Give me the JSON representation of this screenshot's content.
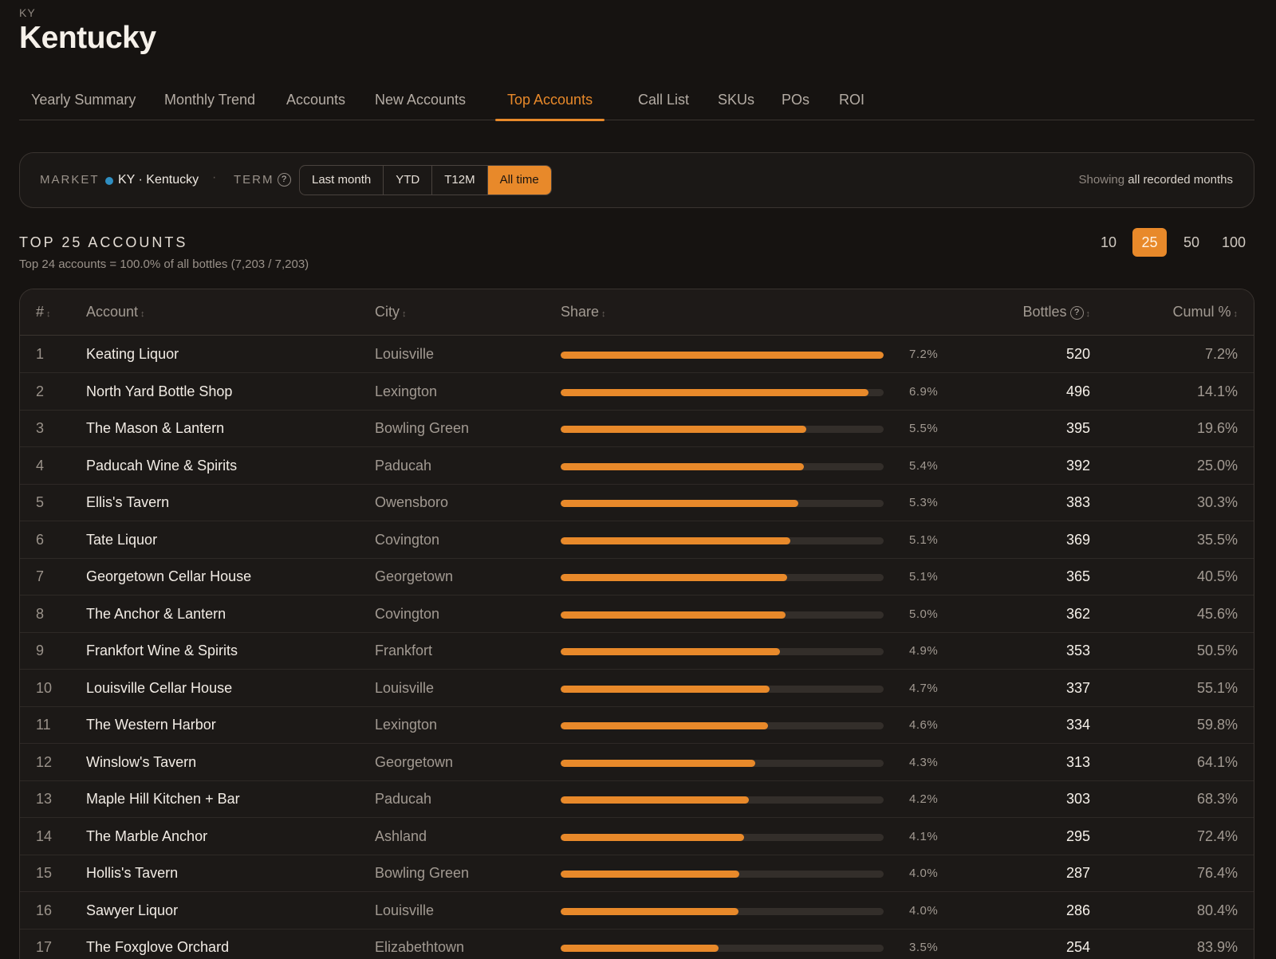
{
  "header": {
    "code": "KY",
    "title": "Kentucky"
  },
  "tabs": [
    {
      "label": "Yearly Summary",
      "active": false
    },
    {
      "label": "Monthly Trend",
      "active": false
    },
    {
      "label": "Accounts",
      "active": false
    },
    {
      "label": "New Accounts",
      "active": false
    },
    {
      "label": "Top Accounts",
      "active": true
    },
    {
      "label": "Call List",
      "active": false
    },
    {
      "label": "SKUs",
      "active": false
    },
    {
      "label": "POs",
      "active": false
    },
    {
      "label": "ROI",
      "active": false
    }
  ],
  "filters": {
    "market_label": "MARKET",
    "market_value": "KY · Kentucky",
    "separator": "·",
    "term_label": "TERM",
    "help_glyph": "?",
    "term_options": [
      "Last month",
      "YTD",
      "T12M",
      "All time"
    ],
    "term_selected": "All time",
    "showing_prefix": "Showing",
    "showing_value": "all recorded months"
  },
  "section": {
    "title": "TOP 25 ACCOUNTS",
    "subtitle": "Top 24 accounts = 100.0% of all bottles (7,203 / 7,203)",
    "size_options": [
      "10",
      "25",
      "50",
      "100"
    ],
    "size_selected": "25"
  },
  "table": {
    "columns": {
      "rank": "#",
      "account": "Account",
      "city": "City",
      "share": "Share",
      "bottles": "Bottles",
      "cumul": "Cumul %"
    },
    "sort_glyph": "↕",
    "rows": [
      {
        "rank": "1",
        "account": "Keating Liquor",
        "city": "Louisville",
        "share_pct": "7.2%",
        "share_fraction": 1.0,
        "bottles": "520",
        "cumul": "7.2%"
      },
      {
        "rank": "2",
        "account": "North Yard Bottle Shop",
        "city": "Lexington",
        "share_pct": "6.9%",
        "share_fraction": 0.954,
        "bottles": "496",
        "cumul": "14.1%"
      },
      {
        "rank": "3",
        "account": "The Mason & Lantern",
        "city": "Bowling Green",
        "share_pct": "5.5%",
        "share_fraction": 0.76,
        "bottles": "395",
        "cumul": "19.6%"
      },
      {
        "rank": "4",
        "account": "Paducah Wine & Spirits",
        "city": "Paducah",
        "share_pct": "5.4%",
        "share_fraction": 0.754,
        "bottles": "392",
        "cumul": "25.0%"
      },
      {
        "rank": "5",
        "account": "Ellis's Tavern",
        "city": "Owensboro",
        "share_pct": "5.3%",
        "share_fraction": 0.737,
        "bottles": "383",
        "cumul": "30.3%"
      },
      {
        "rank": "6",
        "account": "Tate Liquor",
        "city": "Covington",
        "share_pct": "5.1%",
        "share_fraction": 0.71,
        "bottles": "369",
        "cumul": "35.5%"
      },
      {
        "rank": "7",
        "account": "Georgetown Cellar House",
        "city": "Georgetown",
        "share_pct": "5.1%",
        "share_fraction": 0.702,
        "bottles": "365",
        "cumul": "40.5%"
      },
      {
        "rank": "8",
        "account": "The Anchor & Lantern",
        "city": "Covington",
        "share_pct": "5.0%",
        "share_fraction": 0.696,
        "bottles": "362",
        "cumul": "45.6%"
      },
      {
        "rank": "9",
        "account": "Frankfort Wine & Spirits",
        "city": "Frankfort",
        "share_pct": "4.9%",
        "share_fraction": 0.679,
        "bottles": "353",
        "cumul": "50.5%"
      },
      {
        "rank": "10",
        "account": "Louisville Cellar House",
        "city": "Louisville",
        "share_pct": "4.7%",
        "share_fraction": 0.648,
        "bottles": "337",
        "cumul": "55.1%"
      },
      {
        "rank": "11",
        "account": "The Western Harbor",
        "city": "Lexington",
        "share_pct": "4.6%",
        "share_fraction": 0.642,
        "bottles": "334",
        "cumul": "59.8%"
      },
      {
        "rank": "12",
        "account": "Winslow's Tavern",
        "city": "Georgetown",
        "share_pct": "4.3%",
        "share_fraction": 0.602,
        "bottles": "313",
        "cumul": "64.1%"
      },
      {
        "rank": "13",
        "account": "Maple Hill Kitchen + Bar",
        "city": "Paducah",
        "share_pct": "4.2%",
        "share_fraction": 0.583,
        "bottles": "303",
        "cumul": "68.3%"
      },
      {
        "rank": "14",
        "account": "The Marble Anchor",
        "city": "Ashland",
        "share_pct": "4.1%",
        "share_fraction": 0.567,
        "bottles": "295",
        "cumul": "72.4%"
      },
      {
        "rank": "15",
        "account": "Hollis's Tavern",
        "city": "Bowling Green",
        "share_pct": "4.0%",
        "share_fraction": 0.552,
        "bottles": "287",
        "cumul": "76.4%"
      },
      {
        "rank": "16",
        "account": "Sawyer Liquor",
        "city": "Louisville",
        "share_pct": "4.0%",
        "share_fraction": 0.55,
        "bottles": "286",
        "cumul": "80.4%"
      },
      {
        "rank": "17",
        "account": "The Foxglove Orchard",
        "city": "Elizabethtown",
        "share_pct": "3.5%",
        "share_fraction": 0.488,
        "bottles": "254",
        "cumul": "83.9%"
      }
    ]
  },
  "colors": {
    "accent": "#e8892a",
    "market_dot": "#2f8ec1",
    "background": "#161311"
  },
  "icons": {
    "help": "help-circle-icon",
    "sort": "sort-icon",
    "market_dot": "status-dot-icon"
  }
}
